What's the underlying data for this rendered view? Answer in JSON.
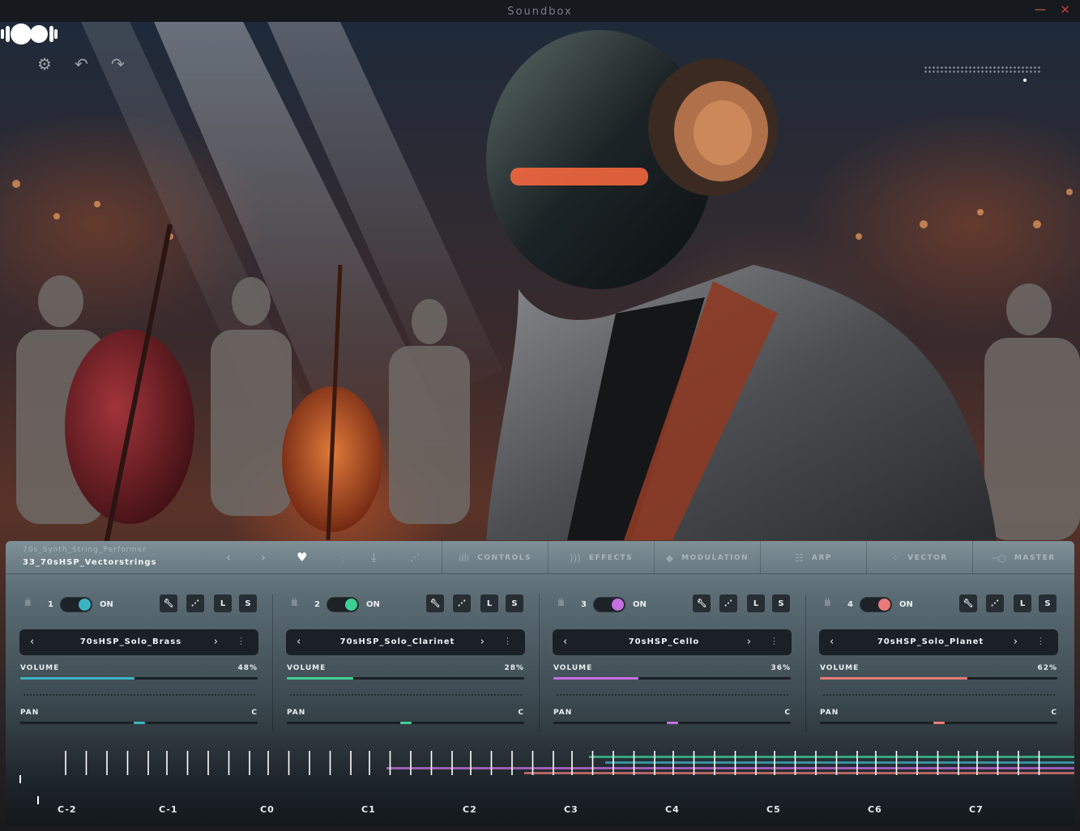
{
  "window": {
    "title": "Soundbox"
  },
  "colors": {
    "accent_1": "#3bb3c3",
    "accent_2": "#3ecf94",
    "accent_3": "#c56fe0",
    "accent_4": "#ea7a7a"
  },
  "header": {
    "settings_icon": "gear-icon",
    "undo_icon": "undo-icon",
    "redo_icon": "redo-icon",
    "logo": "soundbox-logo"
  },
  "preset": {
    "library": "70s_Synth_String_Performer",
    "name": "33_70sHSP_Vectorstrings"
  },
  "tabs": [
    {
      "label": "CONTROLS",
      "icon": "waveform-icon"
    },
    {
      "label": "EFFECTS",
      "icon": "sound-waves-icon"
    },
    {
      "label": "MODULATION",
      "icon": "modulation-icon"
    },
    {
      "label": "ARP",
      "icon": "arp-icon"
    },
    {
      "label": "VECTOR",
      "icon": "vector-grid-icon"
    },
    {
      "label": "MASTER",
      "icon": "slider-icon"
    }
  ],
  "slots": [
    {
      "num": "1",
      "on_label": "ON",
      "sample": "70sHSP_Solo_Brass",
      "volume_label": "VOLUME",
      "volume_text": "48%",
      "volume": 0.48,
      "pan_label": "PAN",
      "pan_text": "C",
      "pan": 0.5,
      "color": "#3bb3c3"
    },
    {
      "num": "2",
      "on_label": "ON",
      "sample": "70sHSP_Solo_Clarinet",
      "volume_label": "VOLUME",
      "volume_text": "28%",
      "volume": 0.28,
      "pan_label": "PAN",
      "pan_text": "C",
      "pan": 0.5,
      "color": "#3ecf94"
    },
    {
      "num": "3",
      "on_label": "ON",
      "sample": "70sHSP_Cello",
      "volume_label": "VOLUME",
      "volume_text": "36%",
      "volume": 0.36,
      "pan_label": "PAN",
      "pan_text": "C",
      "pan": 0.5,
      "color": "#c56fe0"
    },
    {
      "num": "4",
      "on_label": "ON",
      "sample": "70sHSP_Solo_Planet",
      "volume_label": "VOLUME",
      "volume_text": "62%",
      "volume": 0.62,
      "pan_label": "PAN",
      "pan_text": "C",
      "pan": 0.5,
      "color": "#ea7a7a"
    }
  ],
  "slot_buttons": {
    "edit_icon": "wrench-icon",
    "scatter_icon": "scatter-icon",
    "l": "L",
    "s": "S"
  },
  "keyboard": {
    "octaves": [
      "C-2",
      "C-1",
      "C0",
      "C1",
      "C2",
      "C3",
      "C4",
      "C5",
      "C6",
      "C7"
    ]
  }
}
